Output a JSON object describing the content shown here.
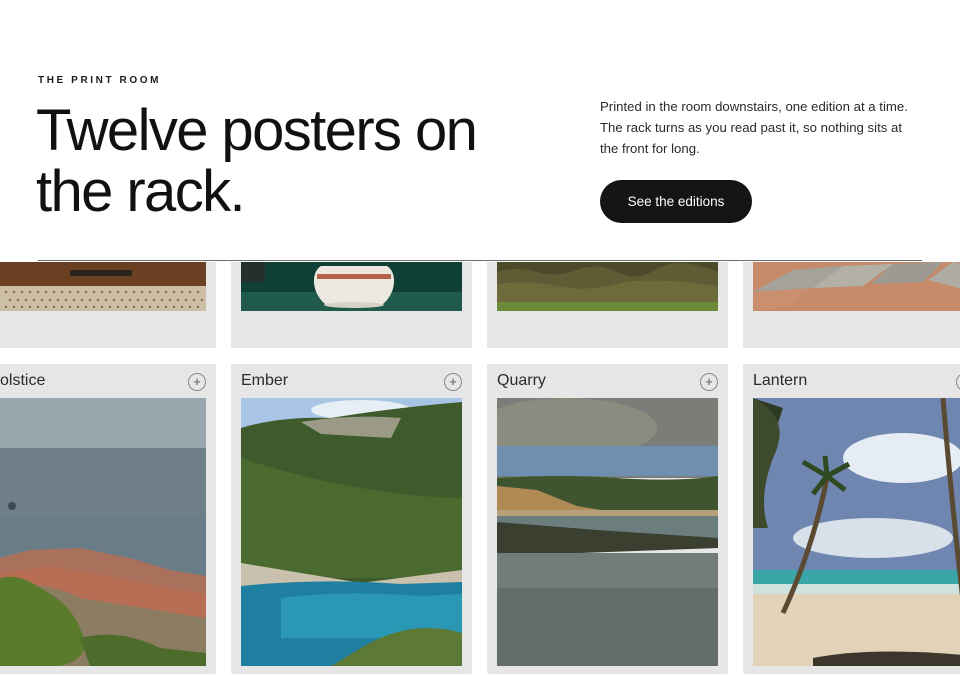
{
  "header": {
    "eyebrow": "THE PRINT ROOM",
    "headline_line1": "Twelve posters on",
    "headline_line2": "the rack.",
    "blurb_line1": "Printed in the room downstairs, one edition at a time.",
    "blurb_line2": "The rack turns as you read past it, so nothing sits at",
    "blurb_line3": "the front for long.",
    "cta_label": "See the editions"
  },
  "rack": {
    "top_row": [
      {
        "id": "top-1",
        "subject": "wicker-chair"
      },
      {
        "id": "top-2",
        "subject": "vase"
      },
      {
        "id": "top-3",
        "subject": "hedge"
      },
      {
        "id": "top-4",
        "subject": "paving"
      }
    ],
    "cards": [
      {
        "title": "olstice",
        "add_icon": "+",
        "subject": "coastal-town"
      },
      {
        "title": "Ember",
        "add_icon": "+",
        "subject": "cove"
      },
      {
        "title": "Quarry",
        "add_icon": "+",
        "subject": "lake"
      },
      {
        "title": "Lantern",
        "add_icon": "+",
        "subject": "palm-beach"
      }
    ]
  }
}
